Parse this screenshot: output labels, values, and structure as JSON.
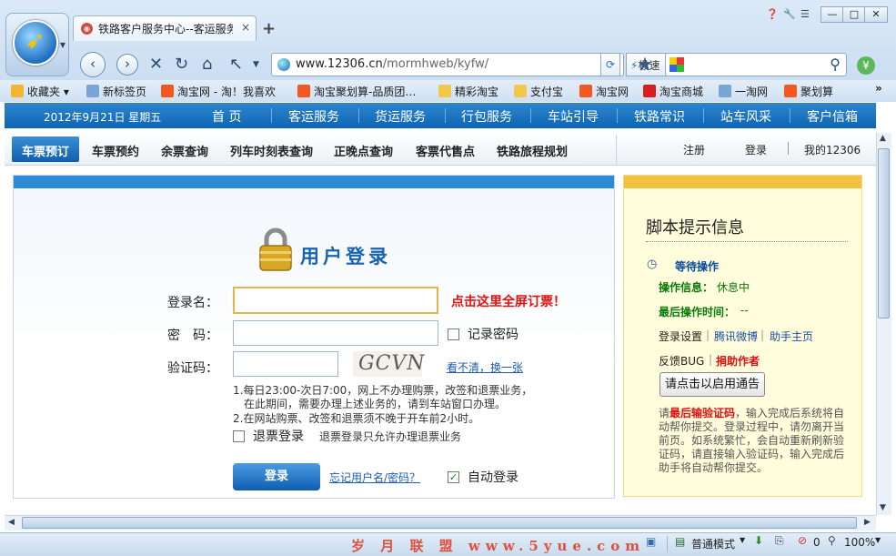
{
  "browser": {
    "tab_title": "铁路客户服务中心--客运服务",
    "tab_close": "×",
    "new_tab": "+",
    "address_host": "www.12306.cn",
    "address_path": "/mormhweb/kyfw/",
    "speed_mode": "极速",
    "search_placeholder": "",
    "window_buttons": [
      "—",
      "□",
      "✕"
    ]
  },
  "bookmarks": [
    {
      "label": "收藏夹",
      "icon": "star-folder-icon"
    },
    {
      "label": "新标签页",
      "icon": "page-icon"
    },
    {
      "label": "淘宝网 - 淘！我喜欢",
      "icon": "taobao-icon"
    },
    {
      "label": "淘宝聚划算-品质团…",
      "icon": "taobao-icon"
    },
    {
      "label": "精彩淘宝",
      "icon": "folder-icon"
    },
    {
      "label": "支付宝",
      "icon": "folder-icon"
    },
    {
      "label": "淘宝网",
      "icon": "taobao-icon"
    },
    {
      "label": "淘宝商城",
      "icon": "tmall-icon"
    },
    {
      "label": "一淘网",
      "icon": "page-icon"
    },
    {
      "label": "聚划算",
      "icon": "taobao-icon"
    }
  ],
  "bookmarks_more": "»",
  "site": {
    "date": "2012年9月21日 星期五",
    "nav": [
      "首 页",
      "客运服务",
      "货运服务",
      "行包服务",
      "车站引导",
      "铁路常识",
      "站车风采",
      "客户信箱"
    ],
    "subnav": [
      "车票预订",
      "车票预约",
      "余票查询",
      "列车时刻表查询",
      "正晚点查询",
      "客票代售点",
      "铁路旅程规划"
    ],
    "subnav_right": [
      "注册",
      "登录",
      "我的12306"
    ]
  },
  "login": {
    "title": "用户登录",
    "username_label": "登录名：",
    "password_label": "密　码：",
    "captcha_label": "验证码：",
    "captcha_text": "GCVN",
    "fullscreen_link": "点击这里全屏订票！",
    "remember_password": "记录密码",
    "not_clear": "看不清，换一张",
    "notes": [
      "1.每日23:00-次日7:00，网上不办理购票，改签和退票业务，",
      "在此期间，需要办理上述业务的，请到车站窗口办理。",
      "2.在网站购票、改签和退票须不晚于开车前2小时。"
    ],
    "refund_login": "退票登录",
    "refund_note": "退票登录只允许办理退票业务",
    "login_button": "登录",
    "forgot_link": "忘记用户名/密码？",
    "auto_login": "自动登录"
  },
  "tips": {
    "title": "脚本提示信息",
    "waiting": "等待操作",
    "op_info_label": "操作信息：",
    "op_info_value": "休息中",
    "last_time_label": "最后操作时间：",
    "last_time_value": "--",
    "links": [
      "登录设置",
      "腾讯微博",
      "助手主页"
    ],
    "feedback": "反馈BUG",
    "donate": "捐助作者",
    "notify_button": "请点击以启用通告",
    "para_prefix": "请",
    "para_highlight": "最后输验证码",
    "para_rest": "，输入完成后系统将自动帮你提交。登录过程中，请勿离开当前页。如系统繁忙，会自动重新刷新验证码，请直接输入验证码，输入完成后助手将自动帮你提交。"
  },
  "status": {
    "watermark": "岁 月 联 盟  www.5yue.com",
    "mode": "普通模式",
    "counter": "0",
    "zoom": "100%"
  },
  "colors": {
    "nav_blue": "#0d64b3",
    "alert_red": "#e01010",
    "tip_green": "#0a7a0a",
    "tip_bg": "#fffddb"
  }
}
